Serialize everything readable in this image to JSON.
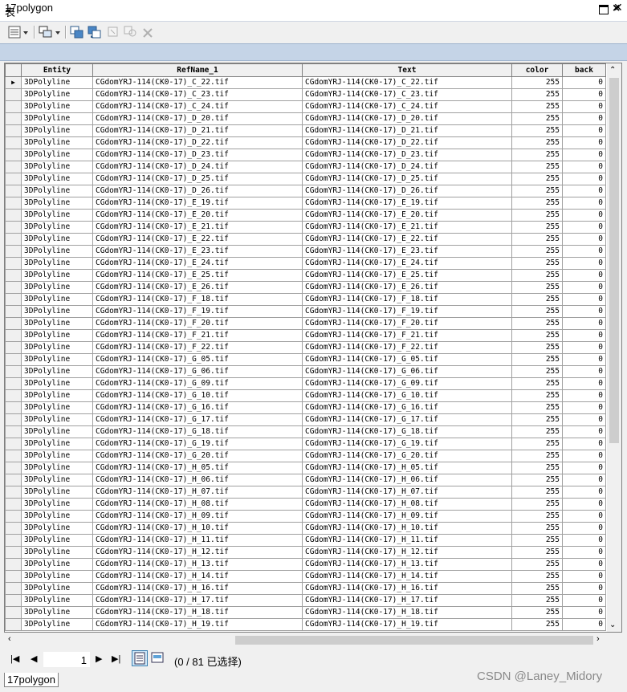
{
  "window": {
    "title": "表",
    "tab_name": "17polygon",
    "bottom_tab": "17polygon"
  },
  "table": {
    "columns": [
      {
        "key": "entity",
        "label": "Entity",
        "width": 89
      },
      {
        "key": "refname",
        "label": "RefName_1",
        "width": 261
      },
      {
        "key": "text",
        "label": "Text",
        "width": 261
      },
      {
        "key": "color",
        "label": "color",
        "width": 63
      },
      {
        "key": "back",
        "label": "back",
        "width": 54
      }
    ],
    "rows": [
      {
        "entity": "3DPolyline",
        "refname": "CGdomYRJ-114(CK0-17)_C_22.tif",
        "text": "CGdomYRJ-114(CK0-17)_C_22.tif",
        "color": "255",
        "back": "0"
      },
      {
        "entity": "3DPolyline",
        "refname": "CGdomYRJ-114(CK0-17)_C_23.tif",
        "text": "CGdomYRJ-114(CK0-17)_C_23.tif",
        "color": "255",
        "back": "0"
      },
      {
        "entity": "3DPolyline",
        "refname": "CGdomYRJ-114(CK0-17)_C_24.tif",
        "text": "CGdomYRJ-114(CK0-17)_C_24.tif",
        "color": "255",
        "back": "0"
      },
      {
        "entity": "3DPolyline",
        "refname": "CGdomYRJ-114(CK0-17)_D_20.tif",
        "text": "CGdomYRJ-114(CK0-17)_D_20.tif",
        "color": "255",
        "back": "0"
      },
      {
        "entity": "3DPolyline",
        "refname": "CGdomYRJ-114(CK0-17)_D_21.tif",
        "text": "CGdomYRJ-114(CK0-17)_D_21.tif",
        "color": "255",
        "back": "0"
      },
      {
        "entity": "3DPolyline",
        "refname": "CGdomYRJ-114(CK0-17)_D_22.tif",
        "text": "CGdomYRJ-114(CK0-17)_D_22.tif",
        "color": "255",
        "back": "0"
      },
      {
        "entity": "3DPolyline",
        "refname": "CGdomYRJ-114(CK0-17)_D_23.tif",
        "text": "CGdomYRJ-114(CK0-17)_D_23.tif",
        "color": "255",
        "back": "0"
      },
      {
        "entity": "3DPolyline",
        "refname": "CGdomYRJ-114(CK0-17)_D_24.tif",
        "text": "CGdomYRJ-114(CK0-17)_D_24.tif",
        "color": "255",
        "back": "0"
      },
      {
        "entity": "3DPolyline",
        "refname": "CGdomYRJ-114(CK0-17)_D_25.tif",
        "text": "CGdomYRJ-114(CK0-17)_D_25.tif",
        "color": "255",
        "back": "0"
      },
      {
        "entity": "3DPolyline",
        "refname": "CGdomYRJ-114(CK0-17)_D_26.tif",
        "text": "CGdomYRJ-114(CK0-17)_D_26.tif",
        "color": "255",
        "back": "0"
      },
      {
        "entity": "3DPolyline",
        "refname": "CGdomYRJ-114(CK0-17)_E_19.tif",
        "text": "CGdomYRJ-114(CK0-17)_E_19.tif",
        "color": "255",
        "back": "0"
      },
      {
        "entity": "3DPolyline",
        "refname": "CGdomYRJ-114(CK0-17)_E_20.tif",
        "text": "CGdomYRJ-114(CK0-17)_E_20.tif",
        "color": "255",
        "back": "0"
      },
      {
        "entity": "3DPolyline",
        "refname": "CGdomYRJ-114(CK0-17)_E_21.tif",
        "text": "CGdomYRJ-114(CK0-17)_E_21.tif",
        "color": "255",
        "back": "0"
      },
      {
        "entity": "3DPolyline",
        "refname": "CGdomYRJ-114(CK0-17)_E_22.tif",
        "text": "CGdomYRJ-114(CK0-17)_E_22.tif",
        "color": "255",
        "back": "0"
      },
      {
        "entity": "3DPolyline",
        "refname": "CGdomYRJ-114(CK0-17)_E_23.tif",
        "text": "CGdomYRJ-114(CK0-17)_E_23.tif",
        "color": "255",
        "back": "0"
      },
      {
        "entity": "3DPolyline",
        "refname": "CGdomYRJ-114(CK0-17)_E_24.tif",
        "text": "CGdomYRJ-114(CK0-17)_E_24.tif",
        "color": "255",
        "back": "0"
      },
      {
        "entity": "3DPolyline",
        "refname": "CGdomYRJ-114(CK0-17)_E_25.tif",
        "text": "CGdomYRJ-114(CK0-17)_E_25.tif",
        "color": "255",
        "back": "0"
      },
      {
        "entity": "3DPolyline",
        "refname": "CGdomYRJ-114(CK0-17)_E_26.tif",
        "text": "CGdomYRJ-114(CK0-17)_E_26.tif",
        "color": "255",
        "back": "0"
      },
      {
        "entity": "3DPolyline",
        "refname": "CGdomYRJ-114(CK0-17)_F_18.tif",
        "text": "CGdomYRJ-114(CK0-17)_F_18.tif",
        "color": "255",
        "back": "0"
      },
      {
        "entity": "3DPolyline",
        "refname": "CGdomYRJ-114(CK0-17)_F_19.tif",
        "text": "CGdomYRJ-114(CK0-17)_F_19.tif",
        "color": "255",
        "back": "0"
      },
      {
        "entity": "3DPolyline",
        "refname": "CGdomYRJ-114(CK0-17)_F_20.tif",
        "text": "CGdomYRJ-114(CK0-17)_F_20.tif",
        "color": "255",
        "back": "0"
      },
      {
        "entity": "3DPolyline",
        "refname": "CGdomYRJ-114(CK0-17)_F_21.tif",
        "text": "CGdomYRJ-114(CK0-17)_F_21.tif",
        "color": "255",
        "back": "0"
      },
      {
        "entity": "3DPolyline",
        "refname": "CGdomYRJ-114(CK0-17)_F_22.tif",
        "text": "CGdomYRJ-114(CK0-17)_F_22.tif",
        "color": "255",
        "back": "0"
      },
      {
        "entity": "3DPolyline",
        "refname": "CGdomYRJ-114(CK0-17)_G_05.tif",
        "text": "CGdomYRJ-114(CK0-17)_G_05.tif",
        "color": "255",
        "back": "0"
      },
      {
        "entity": "3DPolyline",
        "refname": "CGdomYRJ-114(CK0-17)_G_06.tif",
        "text": "CGdomYRJ-114(CK0-17)_G_06.tif",
        "color": "255",
        "back": "0"
      },
      {
        "entity": "3DPolyline",
        "refname": "CGdomYRJ-114(CK0-17)_G_09.tif",
        "text": "CGdomYRJ-114(CK0-17)_G_09.tif",
        "color": "255",
        "back": "0"
      },
      {
        "entity": "3DPolyline",
        "refname": "CGdomYRJ-114(CK0-17)_G_10.tif",
        "text": "CGdomYRJ-114(CK0-17)_G_10.tif",
        "color": "255",
        "back": "0"
      },
      {
        "entity": "3DPolyline",
        "refname": "CGdomYRJ-114(CK0-17)_G_16.tif",
        "text": "CGdomYRJ-114(CK0-17)_G_16.tif",
        "color": "255",
        "back": "0"
      },
      {
        "entity": "3DPolyline",
        "refname": "CGdomYRJ-114(CK0-17)_G_17.tif",
        "text": "CGdomYRJ-114(CK0-17)_G_17.tif",
        "color": "255",
        "back": "0"
      },
      {
        "entity": "3DPolyline",
        "refname": "CGdomYRJ-114(CK0-17)_G_18.tif",
        "text": "CGdomYRJ-114(CK0-17)_G_18.tif",
        "color": "255",
        "back": "0"
      },
      {
        "entity": "3DPolyline",
        "refname": "CGdomYRJ-114(CK0-17)_G_19.tif",
        "text": "CGdomYRJ-114(CK0-17)_G_19.tif",
        "color": "255",
        "back": "0"
      },
      {
        "entity": "3DPolyline",
        "refname": "CGdomYRJ-114(CK0-17)_G_20.tif",
        "text": "CGdomYRJ-114(CK0-17)_G_20.tif",
        "color": "255",
        "back": "0"
      },
      {
        "entity": "3DPolyline",
        "refname": "CGdomYRJ-114(CK0-17)_H_05.tif",
        "text": "CGdomYRJ-114(CK0-17)_H_05.tif",
        "color": "255",
        "back": "0"
      },
      {
        "entity": "3DPolyline",
        "refname": "CGdomYRJ-114(CK0-17)_H_06.tif",
        "text": "CGdomYRJ-114(CK0-17)_H_06.tif",
        "color": "255",
        "back": "0"
      },
      {
        "entity": "3DPolyline",
        "refname": "CGdomYRJ-114(CK0-17)_H_07.tif",
        "text": "CGdomYRJ-114(CK0-17)_H_07.tif",
        "color": "255",
        "back": "0"
      },
      {
        "entity": "3DPolyline",
        "refname": "CGdomYRJ-114(CK0-17)_H_08.tif",
        "text": "CGdomYRJ-114(CK0-17)_H_08.tif",
        "color": "255",
        "back": "0"
      },
      {
        "entity": "3DPolyline",
        "refname": "CGdomYRJ-114(CK0-17)_H_09.tif",
        "text": "CGdomYRJ-114(CK0-17)_H_09.tif",
        "color": "255",
        "back": "0"
      },
      {
        "entity": "3DPolyline",
        "refname": "CGdomYRJ-114(CK0-17)_H_10.tif",
        "text": "CGdomYRJ-114(CK0-17)_H_10.tif",
        "color": "255",
        "back": "0"
      },
      {
        "entity": "3DPolyline",
        "refname": "CGdomYRJ-114(CK0-17)_H_11.tif",
        "text": "CGdomYRJ-114(CK0-17)_H_11.tif",
        "color": "255",
        "back": "0"
      },
      {
        "entity": "3DPolyline",
        "refname": "CGdomYRJ-114(CK0-17)_H_12.tif",
        "text": "CGdomYRJ-114(CK0-17)_H_12.tif",
        "color": "255",
        "back": "0"
      },
      {
        "entity": "3DPolyline",
        "refname": "CGdomYRJ-114(CK0-17)_H_13.tif",
        "text": "CGdomYRJ-114(CK0-17)_H_13.tif",
        "color": "255",
        "back": "0"
      },
      {
        "entity": "3DPolyline",
        "refname": "CGdomYRJ-114(CK0-17)_H_14.tif",
        "text": "CGdomYRJ-114(CK0-17)_H_14.tif",
        "color": "255",
        "back": "0"
      },
      {
        "entity": "3DPolyline",
        "refname": "CGdomYRJ-114(CK0-17)_H_16.tif",
        "text": "CGdomYRJ-114(CK0-17)_H_16.tif",
        "color": "255",
        "back": "0"
      },
      {
        "entity": "3DPolyline",
        "refname": "CGdomYRJ-114(CK0-17)_H_17.tif",
        "text": "CGdomYRJ-114(CK0-17)_H_17.tif",
        "color": "255",
        "back": "0"
      },
      {
        "entity": "3DPolyline",
        "refname": "CGdomYRJ-114(CK0-17)_H_18.tif",
        "text": "CGdomYRJ-114(CK0-17)_H_18.tif",
        "color": "255",
        "back": "0"
      },
      {
        "entity": "3DPolyline",
        "refname": "CGdomYRJ-114(CK0-17)_H_19.tif",
        "text": "CGdomYRJ-114(CK0-17)_H_19.tif",
        "color": "255",
        "back": "0"
      }
    ],
    "current_row_marker": "▶"
  },
  "navigation": {
    "current_record": "1",
    "status": "(0 / 81 已选择)"
  },
  "toolbar": {
    "icons": [
      "table-options-icon",
      "related-tables-icon",
      "select-by-attributes-icon",
      "switch-selection-icon",
      "clear-selection-icon",
      "zoom-to-selected-icon",
      "delete-selected-icon"
    ]
  },
  "watermark": "CSDN @Laney_Midory",
  "colors": {
    "tab_bar": "#c5d4e7",
    "view_toggle_active": "#cde6f7"
  }
}
